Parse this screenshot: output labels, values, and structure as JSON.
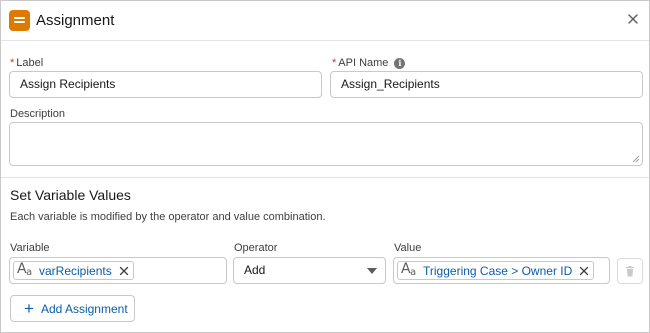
{
  "header": {
    "title": "Assignment",
    "icon": "assignment-icon",
    "icon_color": "#dd7a01"
  },
  "form": {
    "label": {
      "label": "Label",
      "value": "Assign Recipients",
      "required": "*"
    },
    "api_name": {
      "label": "API Name",
      "value": "Assign_Recipients",
      "required": "*",
      "info_glyph": "i"
    },
    "description": {
      "label": "Description",
      "value": ""
    }
  },
  "section": {
    "title": "Set Variable Values",
    "description": "Each variable is modified by the operator and value combination."
  },
  "assignment_row": {
    "variable_label": "Variable",
    "variable_value": "varRecipients",
    "operator_label": "Operator",
    "operator_value": "Add",
    "value_label": "Value",
    "value_value": "Triggering Case > Owner ID"
  },
  "text_type_icon": {
    "big": "A",
    "small": "a"
  },
  "add_button": {
    "plus": "+",
    "label": "Add Assignment"
  },
  "colors": {
    "link": "#0b5cab",
    "required": "#c23934",
    "border": "#c9c9c9"
  }
}
